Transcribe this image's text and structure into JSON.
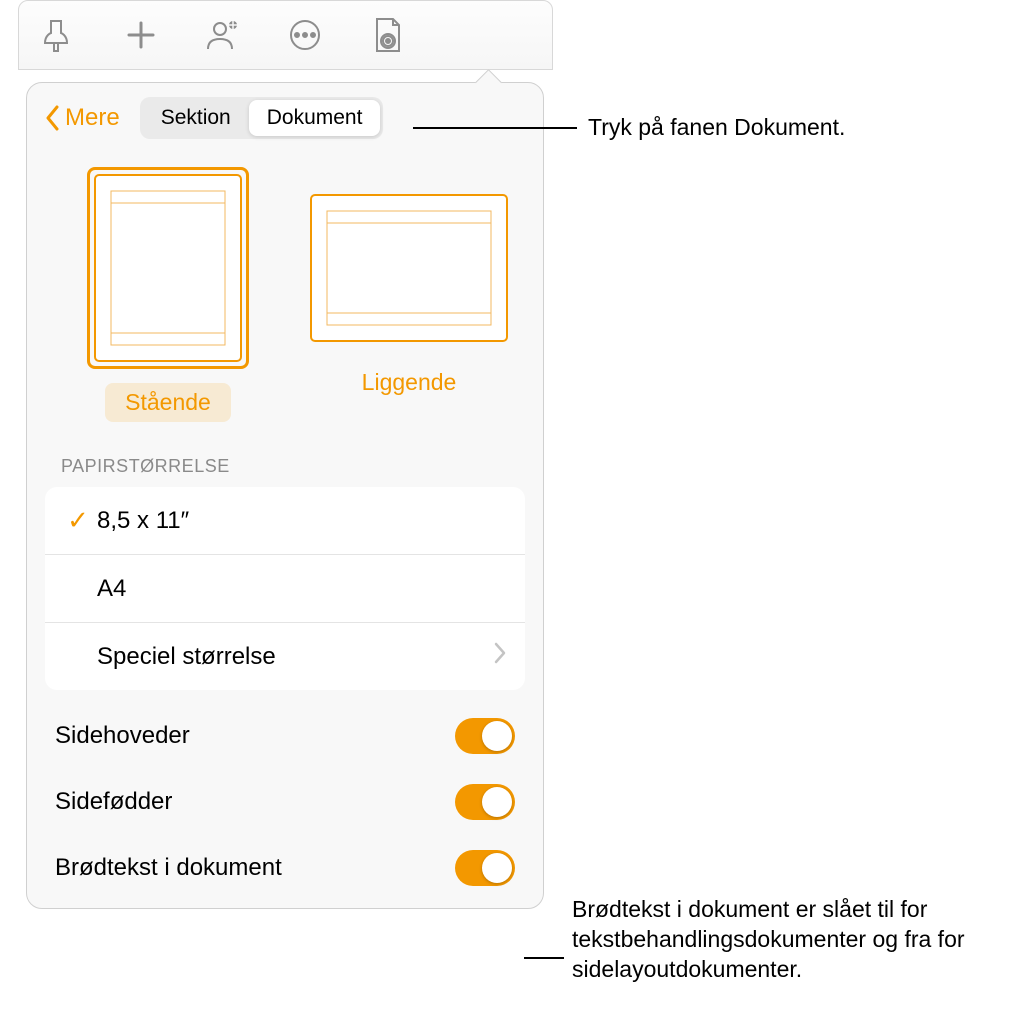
{
  "toolbar": {
    "icons": [
      "format-brush-icon",
      "add-icon",
      "collaborate-icon",
      "more-icon",
      "document-options-icon"
    ]
  },
  "panel": {
    "back_label": "Mere",
    "tabs": [
      {
        "label": "Sektion",
        "active": false
      },
      {
        "label": "Dokument",
        "active": true
      }
    ],
    "orientation": {
      "portrait_label": "Stående",
      "landscape_label": "Liggende",
      "selected": "portrait"
    },
    "paper_size": {
      "title": "PAPIRSTØRRELSE",
      "options": [
        {
          "label": "8,5 x 11″",
          "checked": true
        },
        {
          "label": "A4",
          "checked": false
        },
        {
          "label": "Speciel størrelse",
          "chevron": true
        }
      ]
    },
    "toggles": [
      {
        "label": "Sidehoveder",
        "on": true
      },
      {
        "label": "Sidefødder",
        "on": true
      },
      {
        "label": "Brødtekst i dokument",
        "on": true
      }
    ]
  },
  "callouts": {
    "tab": "Tryk på fanen Dokument.",
    "body": "Brødtekst i dokument er slået til for tekstbehandlingsdokumenter og fra for sidelayoutdokumenter."
  }
}
